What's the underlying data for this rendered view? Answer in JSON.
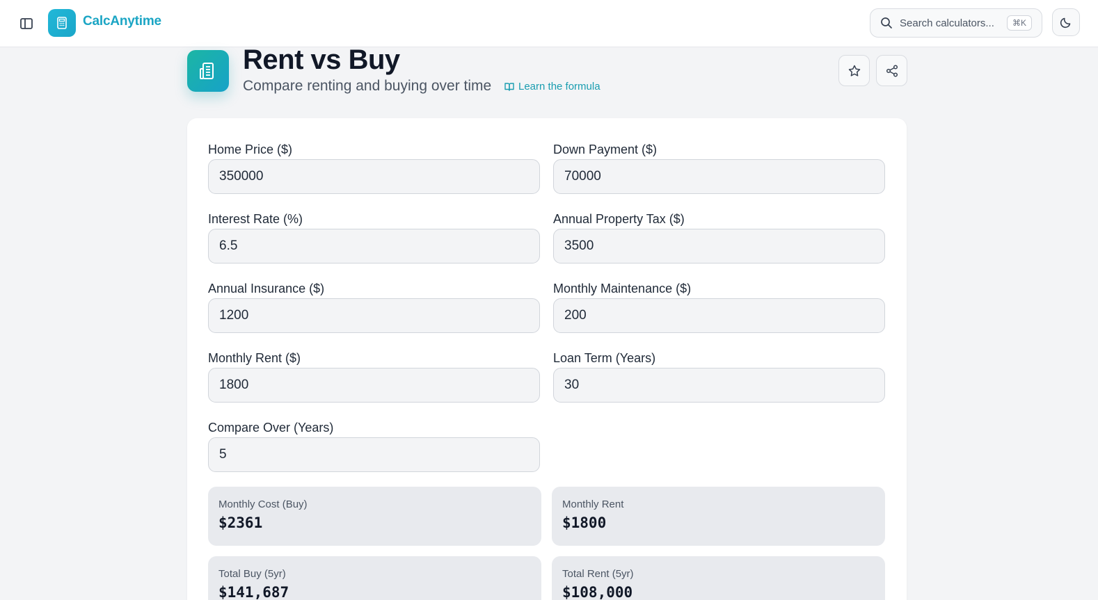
{
  "app": {
    "brand": "CalcAnytime",
    "search_placeholder": "Search calculators...",
    "search_shortcut": "⌘K"
  },
  "header": {
    "title": "Rent vs Buy",
    "subtitle": "Compare renting and buying over time",
    "learn_link": "Learn the formula"
  },
  "fields": [
    {
      "label": "Home Price ($)",
      "value": "350000"
    },
    {
      "label": "Down Payment ($)",
      "value": "70000"
    },
    {
      "label": "Interest Rate (%)",
      "value": "6.5"
    },
    {
      "label": "Annual Property Tax ($)",
      "value": "3500"
    },
    {
      "label": "Annual Insurance ($)",
      "value": "1200"
    },
    {
      "label": "Monthly Maintenance ($)",
      "value": "200"
    },
    {
      "label": "Monthly Rent ($)",
      "value": "1800"
    },
    {
      "label": "Loan Term (Years)",
      "value": "30"
    },
    {
      "label": "Compare Over (Years)",
      "value": "5"
    }
  ],
  "results": [
    {
      "label": "Monthly Cost (Buy)",
      "value": "$2361"
    },
    {
      "label": "Monthly Rent",
      "value": "$1800"
    },
    {
      "label": "Total Buy (5yr)",
      "value": "$141,687"
    },
    {
      "label": "Total Rent (5yr)",
      "value": "$108,000"
    }
  ],
  "colors": {
    "brand": "#1ba5c4",
    "accent_gradient_start": "#1cb6a4",
    "accent_gradient_end": "#17a2c8",
    "page_background": "#f3f4f6"
  },
  "icons": {
    "sidebar_toggle": "sidebar-toggle-icon",
    "logo": "calculator-icon",
    "search": "search-icon",
    "theme": "moon-icon",
    "page_icon": "building-icon",
    "learn": "book-open-icon",
    "favorite": "star-icon",
    "share": "share-icon"
  }
}
